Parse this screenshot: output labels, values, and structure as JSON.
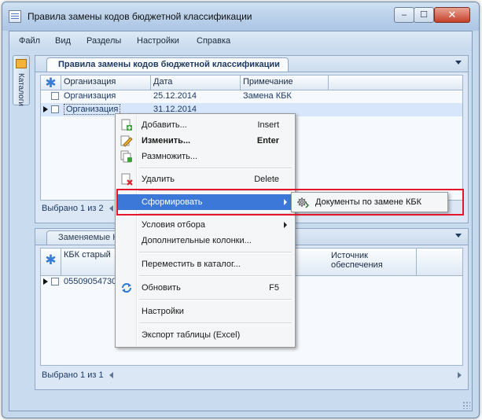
{
  "window": {
    "title": "Правила замены кодов бюджетной классификации",
    "controls": {
      "minimize": "–",
      "maximize": "☐",
      "close": "✕"
    }
  },
  "menubar": [
    "Файл",
    "Вид",
    "Разделы",
    "Настройки",
    "Справка"
  ],
  "sidebar": {
    "catalog_label": "Каталоги"
  },
  "top_panel": {
    "tab_title": "Правила замены кодов бюджетной классификации",
    "columns": [
      "Организация",
      "Дата",
      "Примечание"
    ],
    "rows": [
      {
        "org": "Организация",
        "date": "25.12.2014",
        "note": "Замена КБК"
      },
      {
        "org": "Организация",
        "date": "31.12.2014",
        "note": ""
      }
    ],
    "status": "Выбрано 1 из 2"
  },
  "bottom_panel": {
    "tab_title": "Заменяемые К",
    "columns": [
      "КБК старый",
      "Источник обеспечения"
    ],
    "rows": [
      {
        "kbk_old": "055090547300"
      }
    ],
    "status": "Выбрано 1 из 1"
  },
  "context_menu": {
    "items": [
      {
        "label": "Добавить...",
        "shortcut": "Insert",
        "icon": "add-icon"
      },
      {
        "label": "Изменить...",
        "shortcut": "Enter",
        "icon": "edit-icon",
        "bold": true
      },
      {
        "label": "Размножить...",
        "shortcut": "",
        "icon": "duplicate-icon"
      },
      {
        "label": "Удалить",
        "shortcut": "Delete",
        "icon": "delete-icon"
      },
      {
        "label": "Сформировать",
        "shortcut": "",
        "submenu": true,
        "highlighted": true
      },
      {
        "label": "Условия отбора",
        "shortcut": "",
        "submenu": true
      },
      {
        "label": "Дополнительные колонки...",
        "shortcut": ""
      },
      {
        "label": "Переместить в каталог...",
        "shortcut": ""
      },
      {
        "label": "Обновить",
        "shortcut": "F5",
        "icon": "refresh-icon"
      },
      {
        "label": "Настройки",
        "shortcut": ""
      },
      {
        "label": "Экспорт таблицы (Excel)",
        "shortcut": ""
      }
    ]
  },
  "submenu": {
    "item": "Документы по замене КБК",
    "icon": "gear-doc-icon"
  },
  "colors": {
    "highlight": "#3b78d8",
    "annotation": "#e3162b",
    "window_bg": "#c9dbee"
  }
}
